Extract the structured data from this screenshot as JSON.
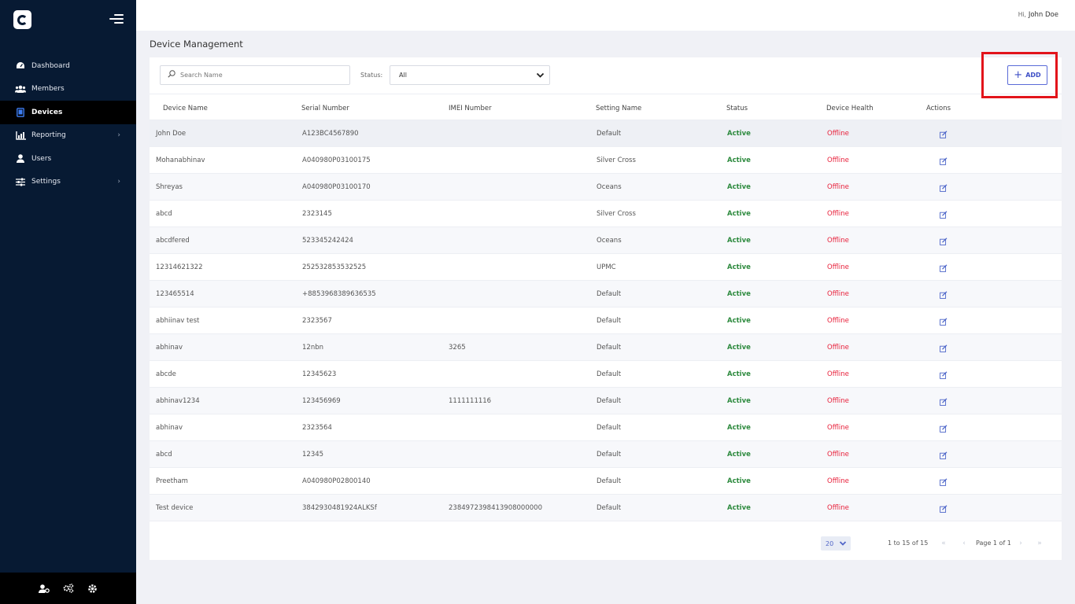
{
  "user": {
    "greeting": "Hi,",
    "name": "John Doe"
  },
  "sidebar": {
    "items": [
      {
        "label": "Dashboard",
        "icon": "dashboard-icon",
        "active": false,
        "chevron": false
      },
      {
        "label": "Members",
        "icon": "members-icon",
        "active": false,
        "chevron": false
      },
      {
        "label": "Devices",
        "icon": "devices-icon",
        "active": true,
        "chevron": false
      },
      {
        "label": "Reporting",
        "icon": "reporting-icon",
        "active": false,
        "chevron": true
      },
      {
        "label": "Users",
        "icon": "user-icon",
        "active": false,
        "chevron": false
      },
      {
        "label": "Settings",
        "icon": "settings-sliders-icon",
        "active": false,
        "chevron": true
      }
    ]
  },
  "page": {
    "title": "Device Management"
  },
  "filters": {
    "search_placeholder": "Search Name",
    "status_label": "Status:",
    "status_value": "All"
  },
  "toolbar": {
    "add_label": "ADD"
  },
  "table": {
    "headers": {
      "name": "Device Name",
      "serial": "Serial Number",
      "imei": "IMEI Number",
      "setting": "Setting Name",
      "status": "Status",
      "health": "Device Health",
      "actions": "Actions"
    },
    "rows": [
      {
        "name": "John Doe",
        "serial": "A123BC4567890",
        "imei": "",
        "setting": "Default",
        "status": "Active",
        "health": "Offline"
      },
      {
        "name": "Mohanabhinav",
        "serial": "A040980P03100175",
        "imei": "",
        "setting": "Silver Cross",
        "status": "Active",
        "health": "Offline"
      },
      {
        "name": "Shreyas",
        "serial": "A040980P03100170",
        "imei": "",
        "setting": "Oceans",
        "status": "Active",
        "health": "Offline"
      },
      {
        "name": "abcd",
        "serial": "2323145",
        "imei": "",
        "setting": "Silver Cross",
        "status": "Active",
        "health": "Offline"
      },
      {
        "name": "abcdfered",
        "serial": "523345242424",
        "imei": "",
        "setting": "Oceans",
        "status": "Active",
        "health": "Offline"
      },
      {
        "name": "12314621322",
        "serial": "252532853532525",
        "imei": "",
        "setting": "UPMC",
        "status": "Active",
        "health": "Offline"
      },
      {
        "name": "123465514",
        "serial": "+8853968389636535",
        "imei": "",
        "setting": "Default",
        "status": "Active",
        "health": "Offline"
      },
      {
        "name": "abhiinav test",
        "serial": "2323567",
        "imei": "",
        "setting": "Default",
        "status": "Active",
        "health": "Offline"
      },
      {
        "name": "abhinav",
        "serial": "12nbn",
        "imei": "3265",
        "setting": "Default",
        "status": "Active",
        "health": "Offline"
      },
      {
        "name": "abcde",
        "serial": "12345623",
        "imei": "",
        "setting": "Default",
        "status": "Active",
        "health": "Offline"
      },
      {
        "name": "abhinav1234",
        "serial": "123456969",
        "imei": "1111111116",
        "setting": "Default",
        "status": "Active",
        "health": "Offline"
      },
      {
        "name": "abhinav",
        "serial": "2323564",
        "imei": "",
        "setting": "Default",
        "status": "Active",
        "health": "Offline"
      },
      {
        "name": "abcd",
        "serial": "12345",
        "imei": "",
        "setting": "Default",
        "status": "Active",
        "health": "Offline"
      },
      {
        "name": "Preetham",
        "serial": "A040980P02800140",
        "imei": "",
        "setting": "Default",
        "status": "Active",
        "health": "Offline"
      },
      {
        "name": "Test device",
        "serial": "3842930481924ALKSf",
        "imei": "2384972398413908000000",
        "setting": "Default",
        "status": "Active",
        "health": "Offline"
      }
    ]
  },
  "pagination": {
    "page_size": "20",
    "range": "1 to 15 of 15",
    "page_info": "Page 1 of 1"
  },
  "colors": {
    "sidebar_bg": "#071a33",
    "active_green": "#2d8a3e",
    "offline_red": "#e8213b",
    "accent_blue": "#3e4fc6",
    "highlight_red": "#e2141b"
  }
}
